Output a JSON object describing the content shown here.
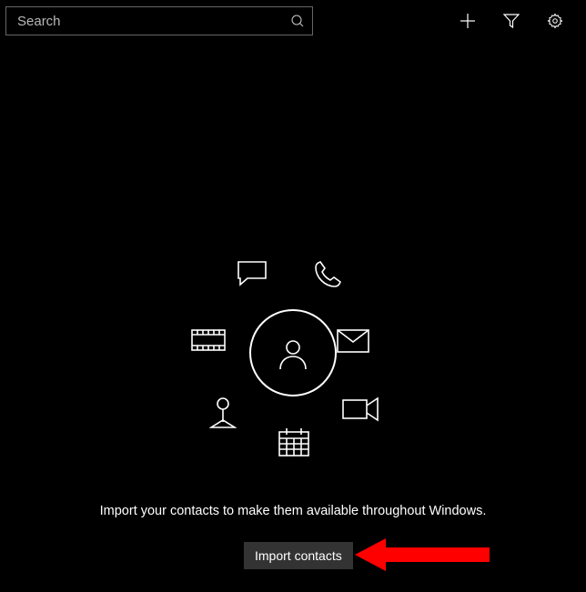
{
  "search": {
    "placeholder": "Search"
  },
  "hint": "Import your contacts to make them available throughout Windows.",
  "import_button": "Import contacts"
}
